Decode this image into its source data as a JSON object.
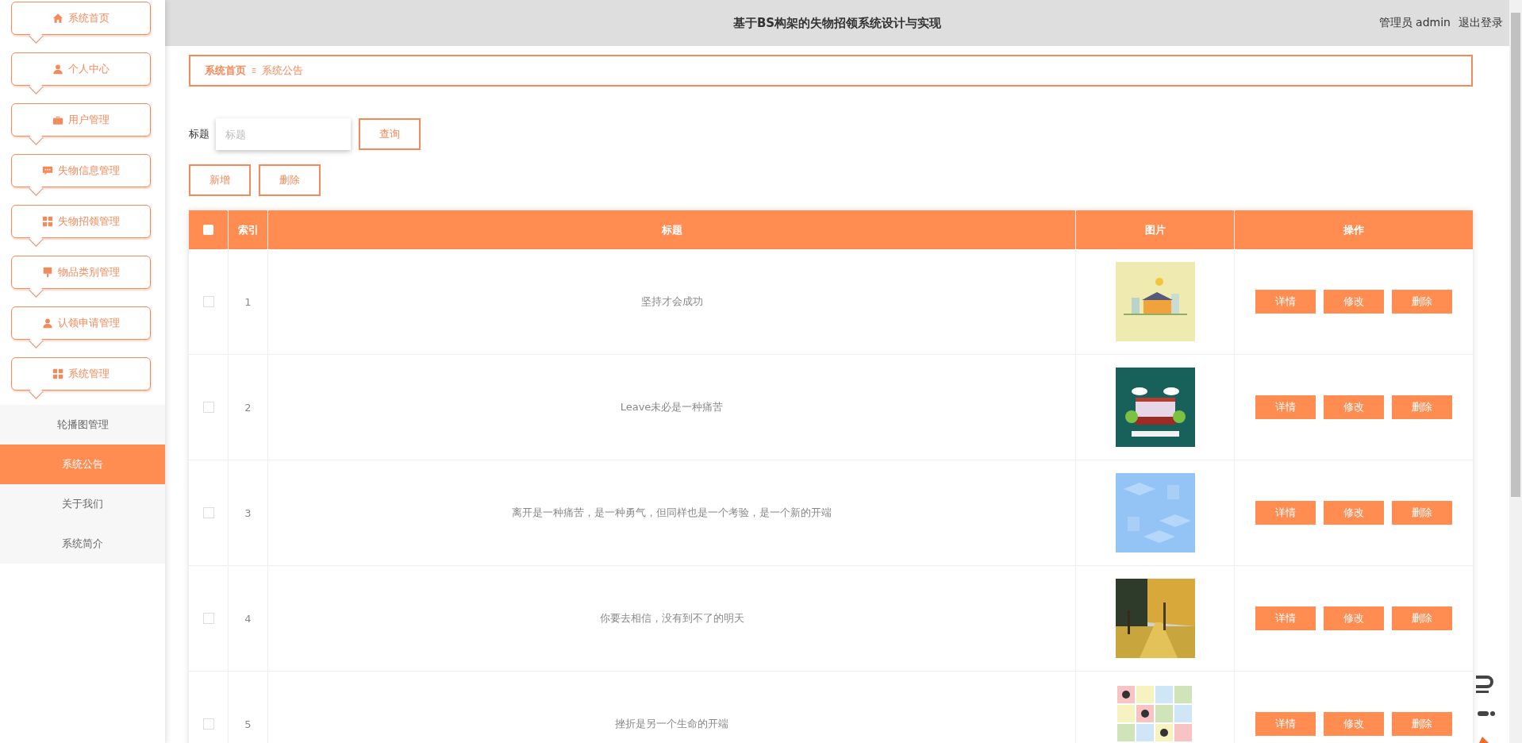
{
  "sidebar": {
    "menu": [
      {
        "label": "系统首页"
      },
      {
        "label": "个人中心"
      },
      {
        "label": "用户管理"
      },
      {
        "label": "失物信息管理"
      },
      {
        "label": "失物招领管理"
      },
      {
        "label": "物品类别管理"
      },
      {
        "label": "认领申请管理"
      },
      {
        "label": "系统管理"
      }
    ],
    "submenu": [
      {
        "label": "轮播图管理",
        "selected": false
      },
      {
        "label": "系统公告",
        "selected": true
      },
      {
        "label": "关于我们",
        "selected": false
      },
      {
        "label": "系统简介",
        "selected": false
      }
    ]
  },
  "header": {
    "title": "基于BS构架的失物招领系统设计与实现",
    "user": "管理员 admin",
    "logout": "退出登录"
  },
  "breadcrumb": [
    {
      "label": "系统首页"
    },
    {
      "label": "系统公告"
    }
  ],
  "search": {
    "label": "标题",
    "placeholder": "标题",
    "button": "查询"
  },
  "actions": [
    "新增",
    "删除"
  ],
  "table": {
    "select_all": {
      "checked": false
    },
    "columns": [
      "索引",
      "标题",
      "图片",
      "操作"
    ],
    "rows": [
      {
        "checked": false,
        "index": "1",
        "title": "坚持才会成功",
        "picture": {
          "kind": "picture"
        },
        "actions": [
          "详情",
          "修改",
          "删除"
        ]
      },
      {
        "checked": false,
        "index": "2",
        "title": "Leave未必是一种痛苦",
        "picture": {
          "kind": "picture"
        },
        "actions": [
          "详情",
          "修改",
          "删除"
        ]
      },
      {
        "checked": false,
        "index": "3",
        "title": "离开是一种痛苦，是一种勇气，但同样也是一个考验，是一个新的开端",
        "picture": {
          "kind": "picture"
        },
        "actions": [
          "详情",
          "修改",
          "删除"
        ]
      },
      {
        "checked": false,
        "index": "4",
        "title": "你要去相信，没有到不了的明天",
        "picture": {
          "kind": "picture"
        },
        "actions": [
          "详情",
          "修改",
          "删除"
        ]
      },
      {
        "checked": false,
        "index": "5",
        "title": "挫折是另一个生命的开端",
        "picture": {
          "kind": "picture"
        },
        "actions": [
          "详情",
          "修改",
          "删除"
        ]
      }
    ]
  }
}
